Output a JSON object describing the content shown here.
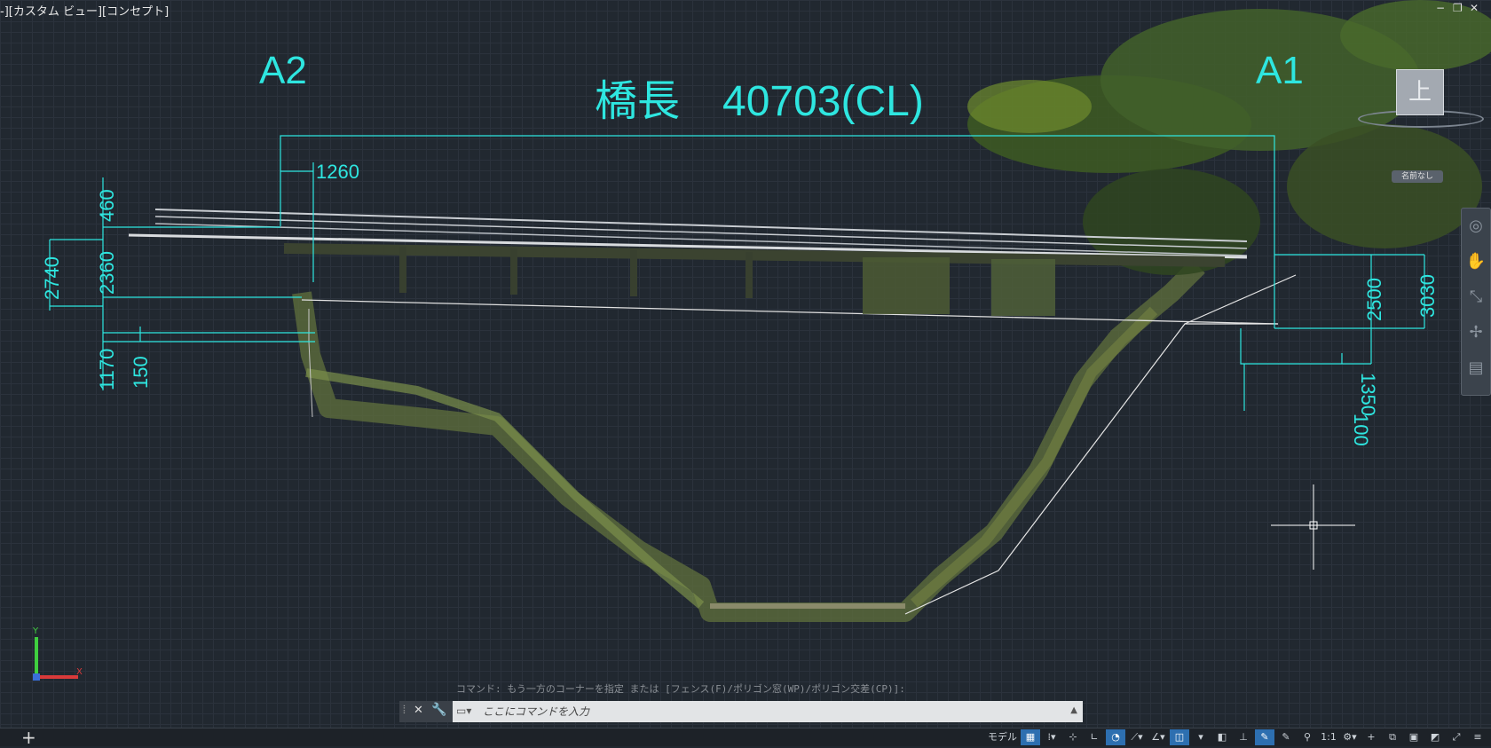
{
  "viewport": {
    "label": "-][カスタム ビュー][コンセプト]",
    "window_controls": [
      "−",
      "❐",
      "✕"
    ]
  },
  "drawing": {
    "abutment_left": "A2",
    "abutment_right": "A1",
    "title": "橋長　40703(CL)",
    "dimensions": {
      "d1260": "1260",
      "d460": "460",
      "d2360": "2360",
      "d2740": "2740",
      "d1170": "1170",
      "d150": "150",
      "d2500": "2500",
      "d3030": "3030",
      "d100": "100",
      "d1350": "1350"
    },
    "ucs": {
      "y": "Y",
      "x": "X"
    }
  },
  "viewcube": {
    "face": "上",
    "named_view": "名前なし"
  },
  "navbar": {
    "icons": [
      "steering-wheel-icon",
      "pan-icon",
      "zoom-icon",
      "orbit-icon",
      "showmotion-icon"
    ]
  },
  "command": {
    "history": "コマンド: もう一方のコーナーを指定 または [フェンス(F)/ポリゴン窓(WP)/ポリゴン交差(CP)]:",
    "placeholder": "ここにコマンドを入力"
  },
  "statusbar": {
    "model_label": "モデル",
    "scale": "1:1"
  },
  "colors": {
    "background": "#212830",
    "dimension": "#2ee6e0",
    "grid": "#2b323c"
  }
}
